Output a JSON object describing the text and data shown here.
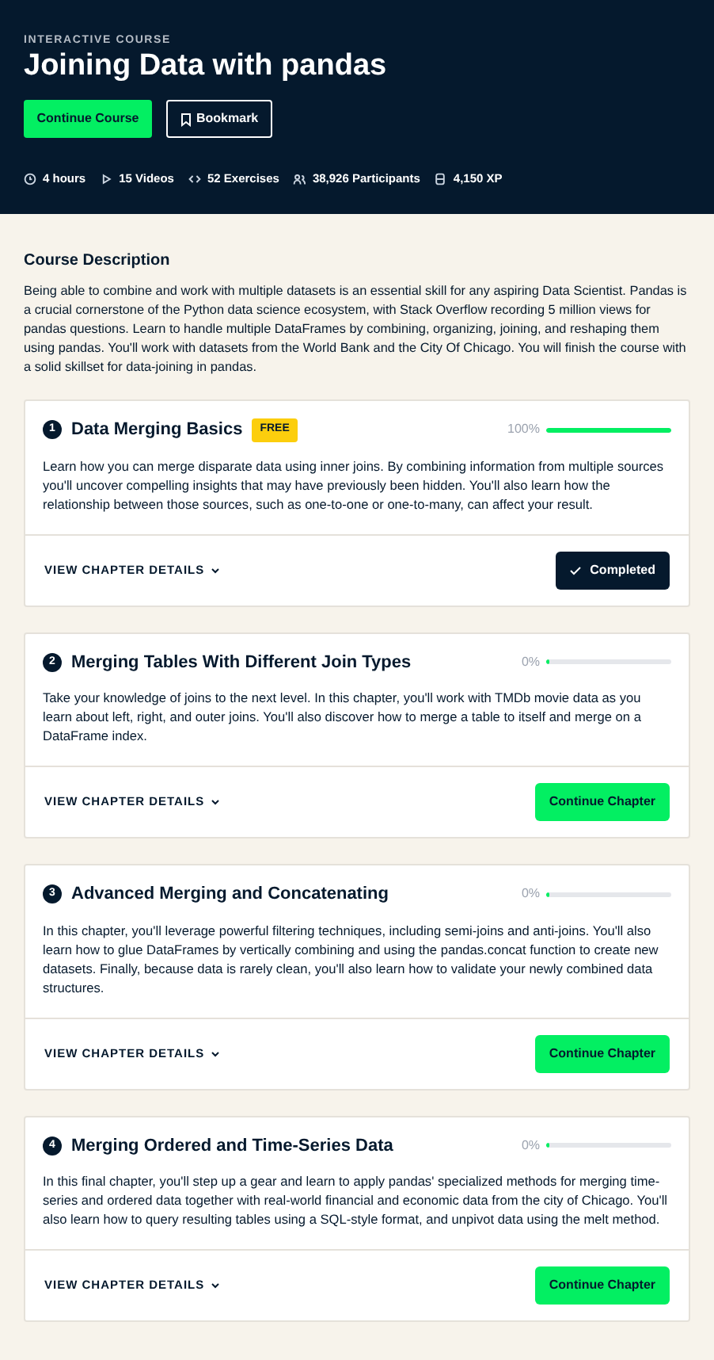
{
  "header": {
    "eyebrow": "INTERACTIVE COURSE",
    "title": "Joining Data with pandas",
    "primary_button": "Continue Course",
    "bookmark_button": "Bookmark",
    "stats": [
      {
        "kind": "time",
        "text": "4 hours"
      },
      {
        "kind": "videos",
        "text": "15 Videos"
      },
      {
        "kind": "exercises",
        "text": "52 Exercises"
      },
      {
        "kind": "participants",
        "text": "38,926 Participants"
      },
      {
        "kind": "xp",
        "text": "4,150 XP"
      }
    ]
  },
  "description": {
    "heading": "Course Description",
    "text": "Being able to combine and work with multiple datasets is an essential skill for any aspiring Data Scientist. Pandas is a crucial cornerstone of the Python data science ecosystem, with Stack Overflow recording 5 million views for pandas questions. Learn to handle multiple DataFrames by combining, organizing, joining, and reshaping them using pandas. You'll work with datasets from the World Bank and the City Of Chicago. You will finish the course with a solid skillset for data-joining in pandas."
  },
  "chapters": [
    {
      "number": "1",
      "title": "Data Merging Basics",
      "badge": "FREE",
      "percent": "100%",
      "level": 1,
      "text": "Learn how you can merge disparate data using inner joins. By combining information from multiple sources you'll uncover compelling insights that may have previously been hidden. You'll also learn how the relationship between those sources, such as one-to-one or one-to-many, can affect your result.",
      "details": "VIEW CHAPTER DETAILS",
      "action": {
        "kind": "completed",
        "label": "Completed"
      }
    },
    {
      "number": "2",
      "title": "Merging Tables With Different Join Types",
      "percent": "0%",
      "level": 0,
      "text": "Take your knowledge of joins to the next level. In this chapter, you'll work with TMDb movie data as you learn about left, right, and outer joins. You'll also discover how to merge a table to itself and merge on a DataFrame index.",
      "details": "VIEW CHAPTER DETAILS",
      "action": {
        "kind": "continue",
        "label": "Continue Chapter"
      }
    },
    {
      "number": "3",
      "title": "Advanced Merging and Concatenating",
      "percent": "0%",
      "level": 0,
      "text": "In this chapter, you'll leverage powerful filtering techniques, including semi-joins and anti-joins. You'll also learn how to glue DataFrames by vertically combining and using the pandas.concat function to create new datasets. Finally, because data is rarely clean, you'll also learn how to validate your newly combined data structures.",
      "details": "VIEW CHAPTER DETAILS",
      "action": {
        "kind": "continue",
        "label": "Continue Chapter"
      }
    },
    {
      "number": "4",
      "title": "Merging Ordered and Time-Series Data",
      "percent": "0%",
      "level": 0,
      "text": "In this final chapter, you'll step up a gear and learn to apply pandas' specialized methods for merging time-series and ordered data together with real-world financial and economic data from the city of Chicago. You'll also learn how to query resulting tables using a SQL-style format, and unpivot data using the melt method.",
      "details": "VIEW CHAPTER DETAILS",
      "action": {
        "kind": "continue",
        "label": "Continue Chapter"
      }
    }
  ]
}
